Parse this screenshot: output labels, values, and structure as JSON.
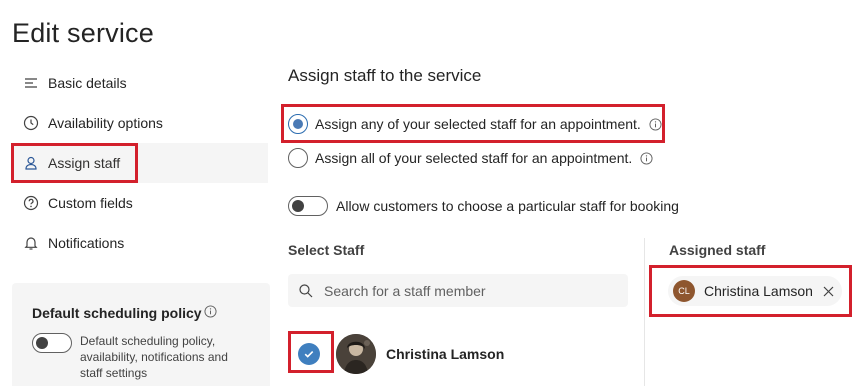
{
  "page": {
    "title": "Edit service"
  },
  "sidebar": {
    "items": [
      {
        "label": "Basic details",
        "icon": "list-icon"
      },
      {
        "label": "Availability options",
        "icon": "clock-icon"
      },
      {
        "label": "Assign staff",
        "icon": "person-icon",
        "active": true
      },
      {
        "label": "Custom fields",
        "icon": "question-icon"
      },
      {
        "label": "Notifications",
        "icon": "bell-icon"
      }
    ]
  },
  "policy": {
    "title": "Default scheduling policy",
    "description": "Default scheduling policy, availability, notifications and staff settings",
    "toggle_on": false
  },
  "main": {
    "section_title": "Assign staff to the service",
    "radio_any": "Assign any of your selected staff for an appointment.",
    "radio_all": "Assign all of your selected staff for an appointment.",
    "selected_radio": "any",
    "allow_toggle_label": "Allow customers to choose a particular staff for booking",
    "allow_toggle_on": false,
    "select_staff_heading": "Select Staff",
    "assigned_staff_heading": "Assigned staff",
    "search": {
      "placeholder": "Search for a staff member",
      "value": ""
    },
    "staff": [
      {
        "name": "Christina Lamson",
        "checked": true
      }
    ],
    "assigned": [
      {
        "name": "Christina Lamson",
        "initials": "CL"
      }
    ]
  },
  "colors": {
    "highlight_border": "#d3202c",
    "accent": "#3f7fbf",
    "chip_avatar": "#8e562e"
  }
}
